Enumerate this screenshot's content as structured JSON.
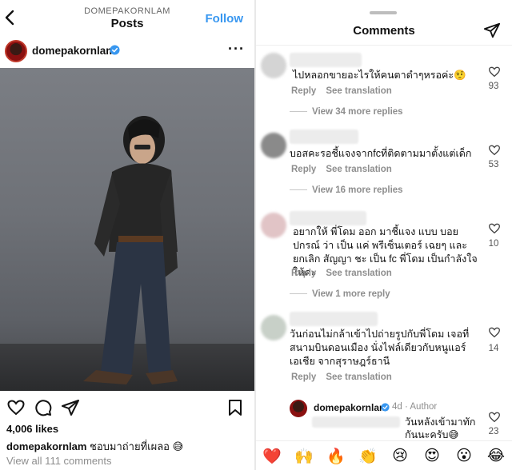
{
  "left": {
    "header": {
      "username": "DOMEPAKORNLAM",
      "title": "Posts",
      "follow_label": "Follow"
    },
    "post": {
      "username": "domepakornlam",
      "likes": "4,006 likes",
      "caption_user": "domepakornlam",
      "caption_text": "ชอบมาถ่ายที่เผลอ 😅",
      "view_all": "View all 111 comments"
    }
  },
  "right": {
    "title": "Comments",
    "reply_label": "Reply",
    "see_translation": "See translation",
    "comments": [
      {
        "text": "ไปหลอกขายอะไรให้คนตาดำๆหรอค่ะ🤨",
        "likes": "93",
        "replies": "View 34 more replies"
      },
      {
        "text": "บอสคะรอชี้แจงจากfcที่ติดตามมาตั้งแต่เด็ก",
        "likes": "53",
        "replies": "View 16 more replies"
      },
      {
        "text": "อยากให้ พี่โดม ออก มาชี้แจง แบบ บอย ปกรณ์ ว่า เป็น แค่ พรีเซ็นเตอร์ เฉยๆ และ ยกเลิก สัญญา ชะ เป็น fc พี่โดม เป็นกำลังใจให้คะ",
        "likes": "10",
        "replies": "View 1 more reply"
      },
      {
        "text": "วันก่อนไม่กล้าเข้าไปถ่ายรูปกับพี่โดม เจอที่ สนามบินดอนเมือง นั่งไฟล์เดียวกับหนูแอร์ เอเชีย จากสุราษฎร์ธานี",
        "likes": "14"
      }
    ],
    "author_reply": {
      "username": "domepakornlam",
      "time": "4d · Author",
      "text": "วันหลังเข้ามาทัก กันนะครับ😅",
      "likes": "23"
    },
    "emojis": [
      "❤️",
      "🙌",
      "🔥",
      "👏",
      "😢",
      "😍",
      "😮",
      "😂"
    ]
  },
  "colors": {
    "accent": "#3897f0",
    "heart_red": "#ed4956"
  }
}
